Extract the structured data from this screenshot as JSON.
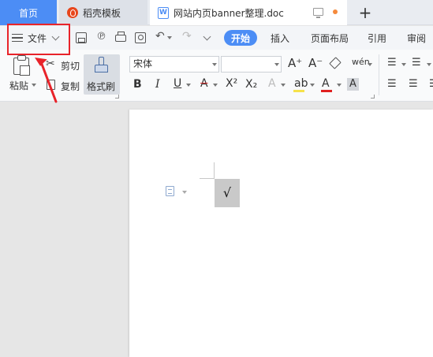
{
  "tabs": {
    "home": "首页",
    "templates": "稻壳模板",
    "document": "网站内页banner整理.doc",
    "new_tab": "+"
  },
  "menu": {
    "file_label": "文件",
    "ribbon_tabs": [
      "开始",
      "插入",
      "页面布局",
      "引用",
      "审阅"
    ]
  },
  "clipboard": {
    "paste": "粘贴",
    "cut": "剪切",
    "copy": "复制",
    "format_painter": "格式刷"
  },
  "font": {
    "name": "宋体",
    "size": "",
    "grow": "A⁺",
    "shrink": "A⁻",
    "phonetic": "wén",
    "bold": "B",
    "italic": "I",
    "underline": "U",
    "strikethrough": "A",
    "superscript": "X²",
    "subscript": "X₂",
    "text_effect": "A",
    "highlight": "ab",
    "font_color": "A",
    "char_shading": "A"
  },
  "paragraph": {
    "bullets": "☰",
    "numbering": "☰",
    "align_left": "☰",
    "align_center": "☰",
    "align_right": "☰"
  },
  "document": {
    "cell_text": "√"
  },
  "colors": {
    "accent": "#4c8df5",
    "highlight_box": "#e8232a",
    "tab_bar": "#e9ecf1",
    "canvas": "#e6e6e6",
    "cell_shading": "#c9c9c9"
  }
}
